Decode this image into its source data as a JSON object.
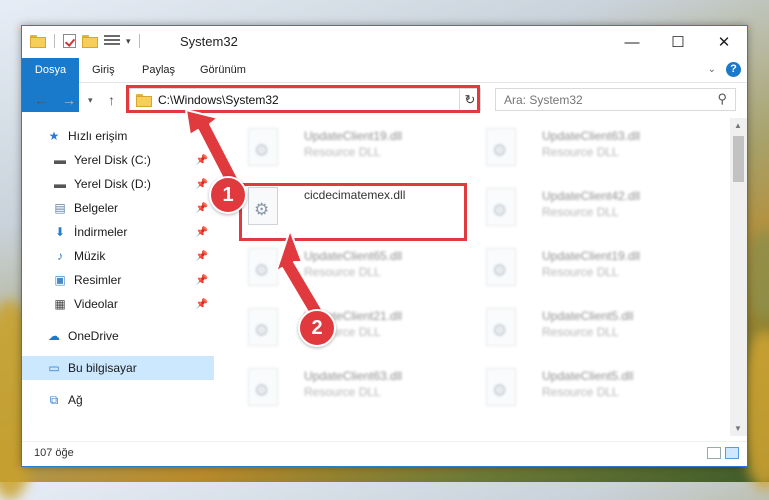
{
  "window": {
    "title": "System32",
    "controls": {
      "minimize": "—",
      "maximize": "☐",
      "close": "✕"
    }
  },
  "ribbon": {
    "tabs": [
      "Dosya",
      "Giriş",
      "Paylaş",
      "Görünüm"
    ],
    "help_label": "?"
  },
  "nav": {
    "address_path": "C:\\Windows\\System32",
    "search_placeholder": "Ara: System32"
  },
  "sidebar": {
    "items": [
      {
        "label": "Hızlı erişim",
        "icon": "star-icon",
        "pinned": false
      },
      {
        "label": "Yerel Disk (C:)",
        "icon": "drive-icon",
        "pinned": true
      },
      {
        "label": "Yerel Disk (D:)",
        "icon": "drive-icon",
        "pinned": true
      },
      {
        "label": "Belgeler",
        "icon": "documents-icon",
        "pinned": true
      },
      {
        "label": "İndirmeler",
        "icon": "download-icon",
        "pinned": true
      },
      {
        "label": "Müzik",
        "icon": "music-icon",
        "pinned": true
      },
      {
        "label": "Resimler",
        "icon": "pictures-icon",
        "pinned": true
      },
      {
        "label": "Videolar",
        "icon": "videos-icon",
        "pinned": true
      },
      {
        "label": "OneDrive",
        "icon": "cloud-icon",
        "pinned": false
      },
      {
        "label": "Bu bilgisayar",
        "icon": "computer-icon",
        "pinned": false,
        "selected": true
      },
      {
        "label": "Ağ",
        "icon": "network-icon",
        "pinned": false
      }
    ]
  },
  "files": {
    "left_column": [
      {
        "name": "UpdateClient19.dll",
        "type": "Resource DLL",
        "blurred": true
      },
      {
        "name": "cicdecimatemex.dll",
        "type": "",
        "blurred": false,
        "highlighted": true
      },
      {
        "name": "UpdateClient65.dll",
        "type": "Resource DLL",
        "blurred": true
      },
      {
        "name": "UpdateClient21.dll",
        "type": "Resource DLL",
        "blurred": true
      },
      {
        "name": "UpdateClient63.dll",
        "type": "Resource DLL",
        "blurred": true
      }
    ],
    "right_column": [
      {
        "name": "UpdateClient63.dll",
        "type": "Resource DLL"
      },
      {
        "name": "UpdateClient42.dll",
        "type": "Resource DLL"
      },
      {
        "name": "UpdateClient19.dll",
        "type": "Resource DLL"
      },
      {
        "name": "UpdateClient5.dll",
        "type": "Resource DLL"
      },
      {
        "name": "UpdateClient5.dll",
        "type": "Resource DLL"
      }
    ]
  },
  "status": {
    "item_count": "107 öğe"
  },
  "annotations": {
    "step1": "1",
    "step2": "2",
    "color": "#e0393e"
  }
}
